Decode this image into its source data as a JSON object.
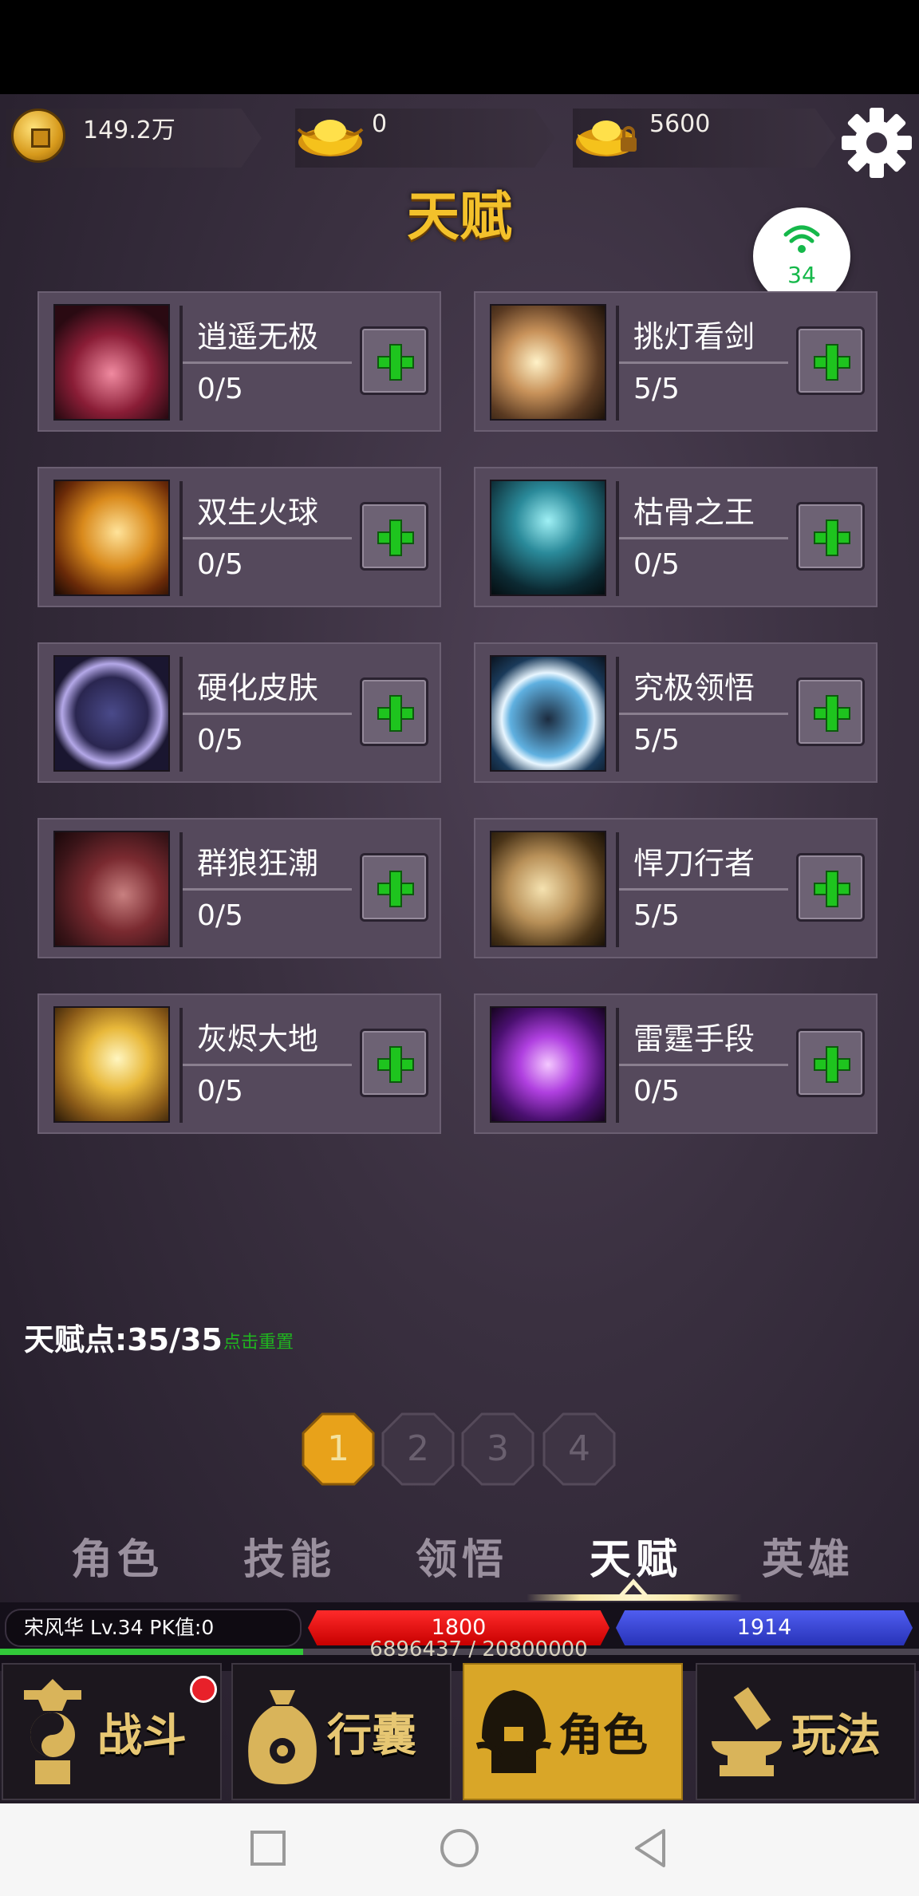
{
  "resources": {
    "copper": "149.2万",
    "gold_ingot": "0",
    "bound_ingot": "5600"
  },
  "title": "天赋",
  "network": {
    "signal": "34"
  },
  "talents": [
    {
      "name": "逍遥无极",
      "level": "0/5",
      "icon": "wheel-fan-icon"
    },
    {
      "name": "挑灯看剑",
      "level": "5/5",
      "icon": "sword-slash-icon"
    },
    {
      "name": "双生火球",
      "level": "0/5",
      "icon": "fireball-icon"
    },
    {
      "name": "枯骨之王",
      "level": "0/5",
      "icon": "bone-king-icon"
    },
    {
      "name": "硬化皮肤",
      "level": "0/5",
      "icon": "armor-icon"
    },
    {
      "name": "究极领悟",
      "level": "5/5",
      "icon": "meditation-icon"
    },
    {
      "name": "群狼狂潮",
      "level": "0/5",
      "icon": "wolf-pack-icon"
    },
    {
      "name": "悍刀行者",
      "level": "5/5",
      "icon": "blade-walker-icon"
    },
    {
      "name": "灰烬大地",
      "level": "0/5",
      "icon": "ash-earth-icon"
    },
    {
      "name": "雷霆手段",
      "level": "0/5",
      "icon": "thunder-fist-icon"
    }
  ],
  "talent_points_label": "天赋点:35/35",
  "reset_label": "点击重置",
  "pages": [
    "1",
    "2",
    "3",
    "4"
  ],
  "active_page": "1",
  "tabs": [
    "角色",
    "技能",
    "领悟",
    "天赋",
    "英雄"
  ],
  "active_tab": "天赋",
  "player": {
    "info": "宋风华  Lv.34  PK值:0",
    "hp": "1800",
    "mp": "1914",
    "exp": "6896437 / 20800000",
    "exp_fraction": 0.33
  },
  "bottom_nav": [
    {
      "label": "战斗",
      "icon": "taiji-statue-icon"
    },
    {
      "label": "行囊",
      "icon": "bag-icon"
    },
    {
      "label": "角色",
      "icon": "helmet-icon"
    },
    {
      "label": "玩法",
      "icon": "anvil-icon"
    }
  ],
  "colors": {
    "accent_gold": "#f3c12b",
    "plus_green": "#1ec41e",
    "hp_red": "#e60000",
    "mp_blue": "#3a46d8"
  }
}
